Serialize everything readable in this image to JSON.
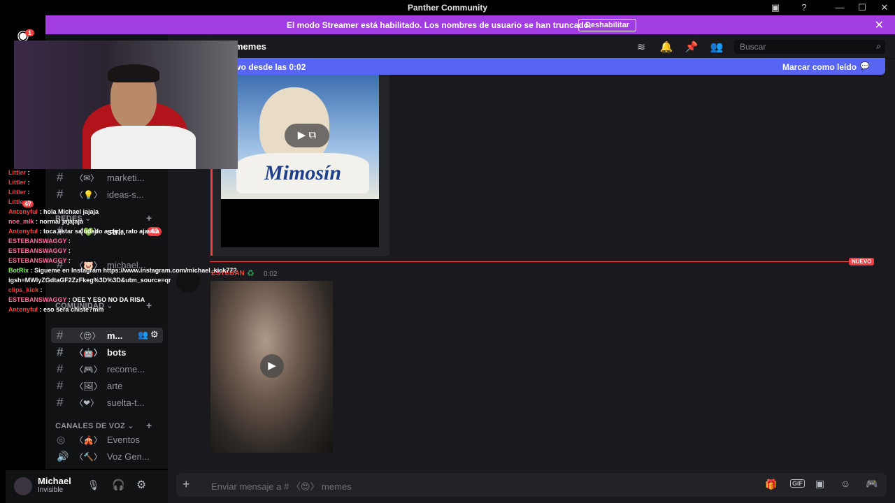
{
  "window": {
    "title": "Panther Community",
    "controls": {
      "minimize": "—",
      "maximize": "☐",
      "close": "✕"
    }
  },
  "banner": {
    "text": "El modo Streamer está habilitado. Los nombres de usuario se han truncado.",
    "button": "Deshabilitar",
    "close": "✕"
  },
  "rail": {
    "mention_badge": "1",
    "badge_47": "47"
  },
  "header": {
    "channel_name": "memes",
    "search_placeholder": "Buscar"
  },
  "new_messages_bar": {
    "text": "vo desde las 0:02",
    "mark_read": "Marcar como leído"
  },
  "sidebar": {
    "channels_top": [
      {
        "emoji": "〈✉〉",
        "label": "marketi..."
      },
      {
        "emoji": "〈💡〉",
        "label": "ideas-s..."
      }
    ],
    "category_redes": "REDES",
    "redes_channels": [
      {
        "emoji": "〈💚〉",
        "label": "str...",
        "badge": "40"
      },
      {
        "emoji": "〈🐷〉",
        "label": "michael..."
      }
    ],
    "category_comunidad": "COMUNIDAD",
    "comunidad_channels": [
      {
        "emoji": "〈😍〉",
        "label": "m..."
      },
      {
        "emoji": "〈🤖〉",
        "label": "bots"
      },
      {
        "emoji": "〈🎮〉",
        "label": "recome..."
      },
      {
        "emoji": "〈🖼〉",
        "label": "arte"
      },
      {
        "emoji": "〈❤〉",
        "label": "suelta-t..."
      }
    ],
    "category_voz": "CANALES DE VOZ",
    "voice_channels": [
      {
        "emoji": "〈🎪〉",
        "label": "Eventos"
      },
      {
        "emoji": "〈🔨〉",
        "label": "Voz Gen..."
      }
    ]
  },
  "user": {
    "name": "Michael",
    "status": "Invisible"
  },
  "messages": {
    "video1_caption": "Mimosín",
    "new_divider": "NUEVO",
    "msg2_author": "ESTEBAN",
    "msg2_time": "0:02"
  },
  "composer": {
    "placeholder": "Enviar mensaje a # 〈😍〉 memes"
  },
  "chat_overlay": [
    {
      "name": "Littler",
      "text": ":"
    },
    {
      "name": "Littler",
      "text": ":"
    },
    {
      "name": "Littler",
      "text": ":"
    },
    {
      "name": "Littler",
      "text": ":"
    },
    {
      "name": "Antonyful",
      "text": ": hola Michael jajaja"
    },
    {
      "name": "noe_mlk",
      "text": ": normal jajajaja"
    },
    {
      "name": "Antonyful",
      "text": ": toca estar saludado a cada rato ajauua"
    },
    {
      "name": "ESTEBANSWAGGY",
      "text": ":"
    },
    {
      "name": "ESTEBANSWAGGY",
      "text": ":"
    },
    {
      "name": "ESTEBANSWAGGY",
      "text": ":"
    },
    {
      "name": "BotRix",
      "text": ": Sigueme en Instagram https://www.instagram.com/michael_kick77?"
    },
    {
      "name": "",
      "text": "igsh=MWlyZGdtaGF2ZzFkeg%3D%3D&utm_source=qr"
    },
    {
      "name": "clips_kick",
      "text": ":"
    },
    {
      "name": "ESTEBANSWAGGY",
      "text": ": OEE Y ESO NO DA RISA"
    },
    {
      "name": "Antonyful",
      "text": ": eso sera chiste?mm"
    }
  ],
  "colors": {
    "banner_purple": "#a13de2",
    "new_bar_blue": "#5865f2",
    "new_divider_red": "#f23f43"
  }
}
